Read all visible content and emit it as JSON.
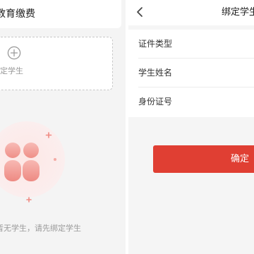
{
  "left": {
    "header_title": "教育缴费",
    "add_card": {
      "icon": "plus-circle-icon",
      "label": "绑定学生"
    },
    "empty_state": {
      "text": "暂无学生，请先绑定学生"
    }
  },
  "right": {
    "nav": {
      "back_icon": "chevron-left-icon",
      "title": "绑定学生"
    },
    "form": {
      "fields": [
        {
          "label": "证件类型"
        },
        {
          "label": "学生姓名"
        },
        {
          "label": "身份证号"
        }
      ]
    },
    "confirm_label": "确定"
  },
  "colors": {
    "accent": "#e03f33",
    "background": "#f4f4f4",
    "muted_text": "#9a9a9a"
  }
}
